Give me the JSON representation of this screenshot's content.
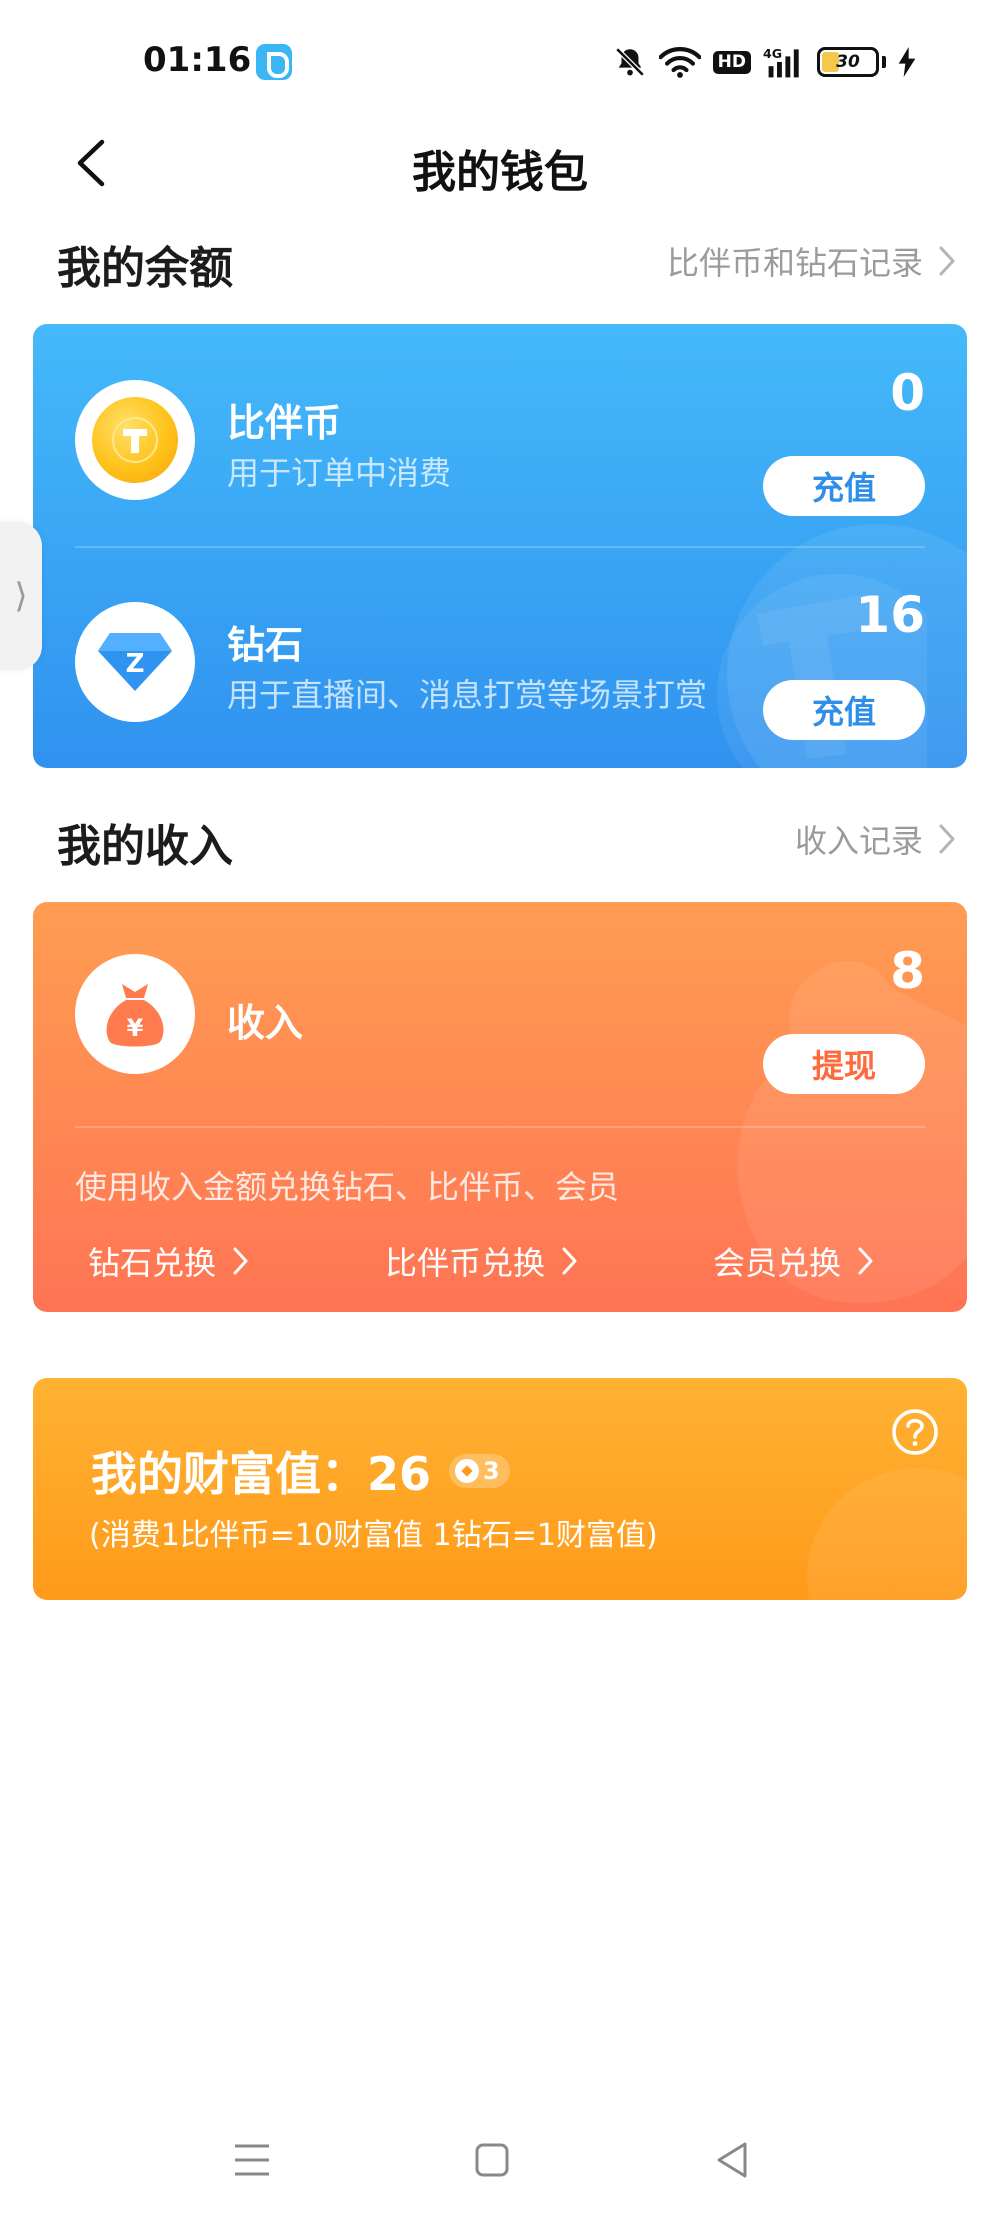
{
  "status_bar": {
    "time": "01:16",
    "app_icon": "app-icon",
    "hd_label": "HD",
    "network_label": "4G",
    "battery_level": "30",
    "icons": [
      "bell-mute-icon",
      "wifi-icon",
      "hd-icon",
      "signal-icon",
      "battery-icon",
      "charging-icon"
    ]
  },
  "header": {
    "title": "我的钱包",
    "back_icon": "back-icon"
  },
  "balance_section": {
    "title": "我的余额",
    "link_label": "比伴币和钻石记录"
  },
  "balance_items": [
    {
      "name": "比伴币",
      "description": "用于订单中消费",
      "amount": "0",
      "button_label": "充值",
      "icon": "coin-icon"
    },
    {
      "name": "钻石",
      "description": "用于直播间、消息打赏等场景打赏",
      "amount": "16",
      "button_label": "充值",
      "icon": "diamond-icon"
    }
  ],
  "income_section": {
    "title": "我的收入",
    "link_label": "收入记录"
  },
  "income": {
    "name": "收入",
    "amount": "8",
    "button_label": "提现",
    "icon": "money-bag-icon",
    "hint": "使用收入金额兑换钻石、比伴币、会员",
    "exchanges": [
      "钻石兑换",
      "比伴币兑换",
      "会员兑换"
    ]
  },
  "wealth": {
    "label": "我的财富值：26",
    "level": "3",
    "note": "(消费1比伴币=10财富值 1钻石=1财富值)",
    "help_icon": "help-icon"
  },
  "side_tab_glyph": "⟩",
  "bottom_nav": {
    "icons": [
      "menu-icon",
      "home-icon",
      "back-triangle-icon"
    ]
  },
  "colors": {
    "blue_card": "#2f92ef",
    "orange_card": "#ff7454",
    "yellow_card": "#ff9a1a"
  }
}
